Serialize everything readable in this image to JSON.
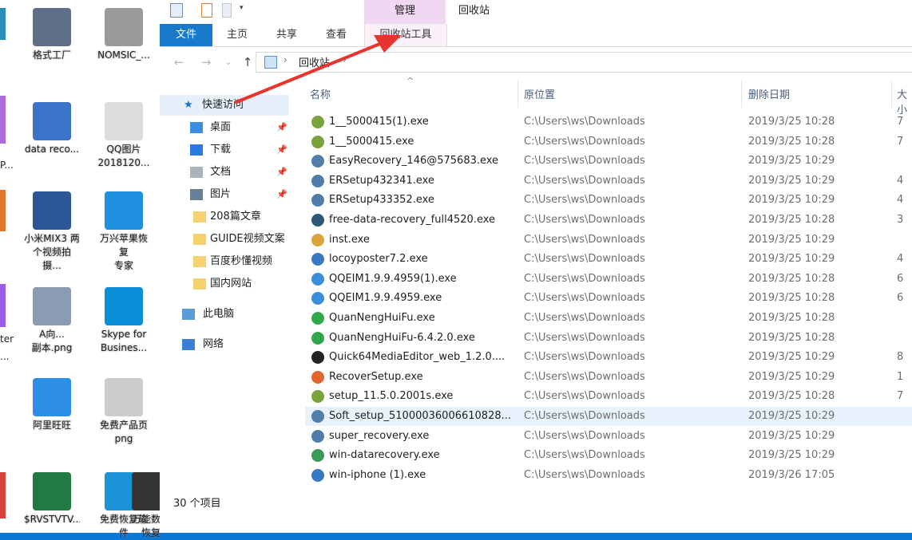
{
  "desktop": {
    "icons": [
      {
        "label": "格式工厂",
        "color": "#5f6f88"
      },
      {
        "label": "NOMSIC_...",
        "color": "#9a9a9a"
      },
      {
        "label": "data reco...",
        "color": "#3b73c9"
      },
      {
        "label": "QQ图片\n2018120...",
        "color": "#dddddd"
      },
      {
        "label": "小米MIX3 两\n个视频拍摄...",
        "color": "#2b5797"
      },
      {
        "label": "万兴苹果恢复\n专家",
        "color": "#1f8fe0"
      },
      {
        "label": "A向...\n副本.png",
        "color": "#8a9bb3"
      },
      {
        "label": "Skype for\nBusines...",
        "color": "#0a8fd8"
      },
      {
        "label": "阿里旺旺",
        "color": "#2d8ee8"
      },
      {
        "label": "免费产品页\npng",
        "color": "#cccccc"
      },
      {
        "label": "$RVSTVTV...",
        "color": "#207a42"
      },
      {
        "label": "免费恢复软件",
        "color": "#1a94d6"
      },
      {
        "label": "万能数据恢复",
        "color": "#333333"
      }
    ],
    "edge_labels": [
      "P...",
      "ter",
      "..."
    ]
  },
  "titlebar": {
    "context_tab": "管理",
    "title": "回收站"
  },
  "ribbon": {
    "tabs": [
      "文件",
      "主页",
      "共享",
      "查看",
      "回收站工具"
    ]
  },
  "address": {
    "back": "←",
    "forward": "→",
    "recent": "⌄",
    "up": "↑",
    "sep1": "›",
    "crumb": "回收站",
    "sep2": "›"
  },
  "nav": {
    "items": [
      {
        "label": "快速访问",
        "icon": "star-icon",
        "color": "#1e6fd6",
        "pinned": false
      },
      {
        "label": "桌面",
        "icon": "desktop-icon",
        "color": "#3a8ee6",
        "pinned": true
      },
      {
        "label": "下载",
        "icon": "download-icon",
        "color": "#2a7ae2",
        "pinned": true
      },
      {
        "label": "文档",
        "icon": "document-icon",
        "color": "#aab4c0",
        "pinned": true
      },
      {
        "label": "图片",
        "icon": "picture-icon",
        "color": "#6a7f99",
        "pinned": true
      },
      {
        "label": "208篇文章",
        "icon": "folder-icon",
        "color": "#f5d26d",
        "pinned": false
      },
      {
        "label": "GUIDE视频文案",
        "icon": "folder-icon",
        "color": "#f5d26d",
        "pinned": false
      },
      {
        "label": "百度秒懂视频",
        "icon": "folder-icon",
        "color": "#f5d26d",
        "pinned": false
      },
      {
        "label": "国内网站",
        "icon": "folder-icon",
        "color": "#f5d26d",
        "pinned": false
      },
      {
        "label": "此电脑",
        "icon": "computer-icon",
        "color": "#5b9bd8",
        "pinned": false
      },
      {
        "label": "网络",
        "icon": "network-icon",
        "color": "#3b7fd0",
        "pinned": false
      }
    ],
    "pin_glyph": "📌"
  },
  "list": {
    "columns": [
      "名称",
      "原位置",
      "删除日期",
      "大小"
    ],
    "sort_glyph": "^",
    "files": [
      {
        "name": "1__5000415(1).exe",
        "path": "C:\\Users\\ws\\Downloads",
        "date": "2019/3/25 10:28",
        "size": "7",
        "icon_color": "#7aa23a"
      },
      {
        "name": "1__5000415.exe",
        "path": "C:\\Users\\ws\\Downloads",
        "date": "2019/3/25 10:28",
        "size": "7",
        "icon_color": "#7aa23a"
      },
      {
        "name": "EasyRecovery_146@575683.exe",
        "path": "C:\\Users\\ws\\Downloads",
        "date": "2019/3/25 10:29",
        "size": "",
        "icon_color": "#4f7fa8"
      },
      {
        "name": "ERSetup432341.exe",
        "path": "C:\\Users\\ws\\Downloads",
        "date": "2019/3/25 10:29",
        "size": "4",
        "icon_color": "#4f7fa8"
      },
      {
        "name": "ERSetup433352.exe",
        "path": "C:\\Users\\ws\\Downloads",
        "date": "2019/3/25 10:29",
        "size": "4",
        "icon_color": "#4f7fa8"
      },
      {
        "name": "free-data-recovery_full4520.exe",
        "path": "C:\\Users\\ws\\Downloads",
        "date": "2019/3/25 10:28",
        "size": "3",
        "icon_color": "#2f5878"
      },
      {
        "name": "inst.exe",
        "path": "C:\\Users\\ws\\Downloads",
        "date": "2019/3/25 10:29",
        "size": "",
        "icon_color": "#d9a43a"
      },
      {
        "name": "locoyposter7.2.exe",
        "path": "C:\\Users\\ws\\Downloads",
        "date": "2019/3/25 10:29",
        "size": "4",
        "icon_color": "#3a79c0"
      },
      {
        "name": "QQEIM1.9.9.4959(1).exe",
        "path": "C:\\Users\\ws\\Downloads",
        "date": "2019/3/25 10:28",
        "size": "6",
        "icon_color": "#3b8fd9"
      },
      {
        "name": "QQEIM1.9.9.4959.exe",
        "path": "C:\\Users\\ws\\Downloads",
        "date": "2019/3/25 10:28",
        "size": "6",
        "icon_color": "#3b8fd9"
      },
      {
        "name": "QuanNengHuiFu.exe",
        "path": "C:\\Users\\ws\\Downloads",
        "date": "2019/3/25 10:28",
        "size": "",
        "icon_color": "#2fa84a"
      },
      {
        "name": "QuanNengHuiFu-6.4.2.0.exe",
        "path": "C:\\Users\\ws\\Downloads",
        "date": "2019/3/25 10:28",
        "size": "",
        "icon_color": "#2fa84a"
      },
      {
        "name": "Quick64MediaEditor_web_1.2.0....",
        "path": "C:\\Users\\ws\\Downloads",
        "date": "2019/3/25 10:29",
        "size": "8",
        "icon_color": "#222222"
      },
      {
        "name": "RecoverSetup.exe",
        "path": "C:\\Users\\ws\\Downloads",
        "date": "2019/3/25 10:29",
        "size": "1",
        "icon_color": "#e2672f"
      },
      {
        "name": "setup_11.5.0.2001s.exe",
        "path": "C:\\Users\\ws\\Downloads",
        "date": "2019/3/25 10:28",
        "size": "7",
        "icon_color": "#7aa23a"
      },
      {
        "name": "Soft_setup_5100003600661082­8...",
        "path": "C:\\Users\\ws\\Downloads",
        "date": "2019/3/25 10:29",
        "size": "",
        "icon_color": "#4f7fa8",
        "selected": true
      },
      {
        "name": "super_recovery.exe",
        "path": "C:\\Users\\ws\\Downloads",
        "date": "2019/3/25 10:29",
        "size": "",
        "icon_color": "#4f7fa8"
      },
      {
        "name": "win-datarecovery.exe",
        "path": "C:\\Users\\ws\\Downloads",
        "date": "2019/3/25 10:29",
        "size": "",
        "icon_color": "#3a9a5a"
      },
      {
        "name": "win-iphone (1).exe",
        "path": "C:\\Users\\ws\\Downloads",
        "date": "2019/3/26 17:05",
        "size": "",
        "icon_color": "#3a79c0"
      }
    ]
  },
  "status": {
    "count": "30 个项目"
  },
  "colors": {
    "annotation_arrow": "#e8342e",
    "accent": "#1979ca"
  }
}
